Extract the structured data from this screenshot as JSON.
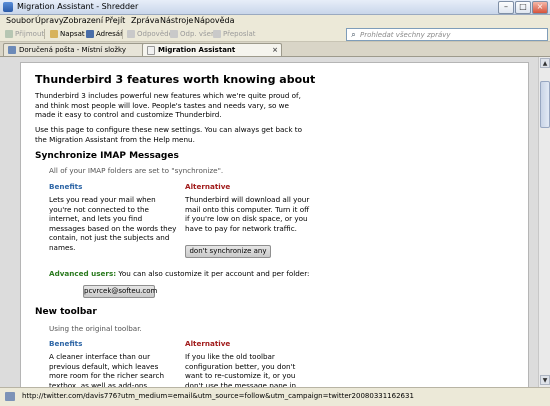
{
  "window": {
    "title": "Migration Assistant - Shredder"
  },
  "menu": [
    "Soubor",
    "Úpravy",
    "Zobrazení",
    "Přejít",
    "Zpráva",
    "Nástroje",
    "Nápověda"
  ],
  "toolbar": {
    "get_mail": "Přijmout",
    "write": "Napsat",
    "address_book": "Adresář",
    "reply": "Odpovědět",
    "reply_all": "Odp. všem",
    "forward": "Přeposlat"
  },
  "search": {
    "placeholder": "Prohledat všechny zprávy"
  },
  "tabs": [
    {
      "label": "Doručená pošta - Místní složky"
    },
    {
      "label": "Migration Assistant"
    }
  ],
  "page": {
    "title": "Thunderbird 3 features worth knowing about",
    "intro": "Thunderbird 3 includes powerful new features which we're quite proud of, and think most people will love. People's tastes and needs vary, so we made it easy to control and customize Thunderbird.",
    "howto": "Use this page to configure these new settings. You can always get back to the Migration Assistant from the Help menu.",
    "imap": {
      "heading": "Synchronize IMAP Messages",
      "status": "All of your IMAP folders are set to \"synchronize\".",
      "benefits_label": "Benefits",
      "benefits_text": "Lets you read your mail when you're not connected to the internet, and lets you find messages based on the words they contain, not just the subjects and names.",
      "alternative_label": "Alternative",
      "alternative_text": "Thunderbird will download all your mail onto this computer. Turn it off if you're low on disk space, or you have to pay for network traffic.",
      "button": "don't synchronize any",
      "advanced_label": "Advanced users:",
      "advanced_text": "You can also customize it per account and per folder:",
      "account_button": "pcvrcek@softeu.com"
    },
    "toolbar_section": {
      "heading": "New toolbar",
      "status": "Using the original toolbar.",
      "benefits_label": "Benefits",
      "benefits_text": "A cleaner interface than our previous default, which leaves more room for the richer search textbox, as well as add-ons.",
      "alternative_label": "Alternative",
      "alternative_text": "If you like the old toolbar configuration better, you don't want to re-customize it, or you don't use the message pane in your layout."
    }
  },
  "status": {
    "url": "http://twitter.com/davis776?utm_medium=email&utm_source=follow&utm_campaign=twitter20080331162631"
  }
}
